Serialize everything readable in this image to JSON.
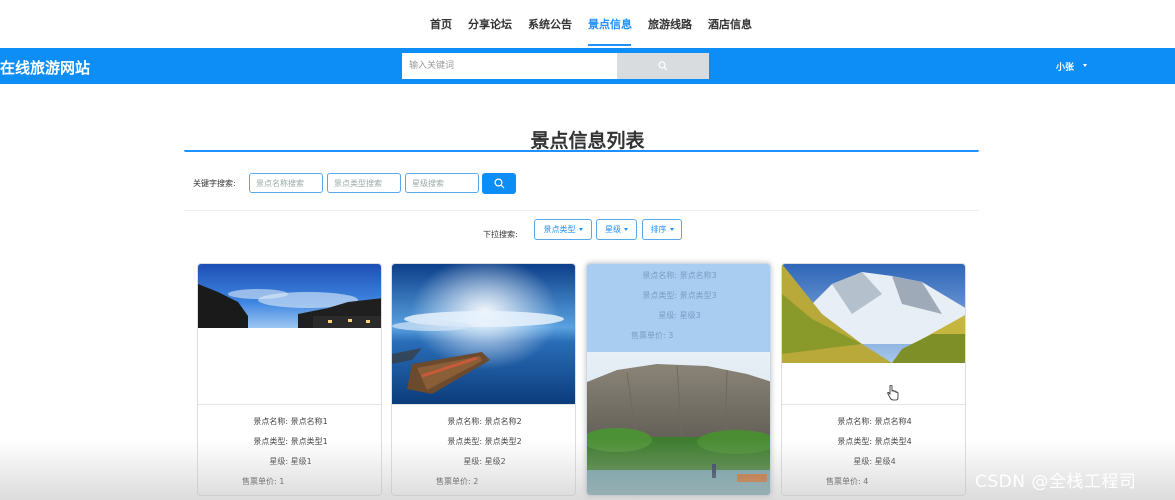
{
  "nav": {
    "items": [
      {
        "label": "首页"
      },
      {
        "label": "分享论坛"
      },
      {
        "label": "系统公告"
      },
      {
        "label": "景点信息"
      },
      {
        "label": "旅游线路"
      },
      {
        "label": "酒店信息"
      }
    ],
    "active": "景点信息"
  },
  "header": {
    "site_title": "在线旅游网站",
    "search_placeholder": "输入关键词",
    "user_name": "小张",
    "bar_color": "#0d8ef7"
  },
  "page": {
    "title": "景点信息列表",
    "keyword_label": "关键字搜索:",
    "name_placeholder": "景点名称搜索",
    "type_placeholder": "景点类型搜索",
    "level_placeholder": "星级搜索",
    "dropdown_label": "下拉搜索:",
    "dropdowns": [
      {
        "label": "景点类型"
      },
      {
        "label": "星级"
      },
      {
        "label": "排序"
      }
    ]
  },
  "cards": [
    {
      "name": "景点名称: 景点名称1",
      "type": "景点类型: 景点类型1",
      "level": "星级: 星级1",
      "price": "售票单价: 1"
    },
    {
      "name": "景点名称: 景点名称2",
      "type": "景点类型: 景点类型2",
      "level": "星级: 星级2",
      "price": "售票单价: 2"
    },
    {
      "name": "景点名称: 景点名称3",
      "type": "景点类型: 景点类型3",
      "level": "星级: 星级3",
      "price": "售票单价: 3"
    },
    {
      "name": "景点名称: 景点名称4",
      "type": "景点类型: 景点类型4",
      "level": "星级: 星级4",
      "price": "售票单价: 4"
    }
  ],
  "watermark": "CSDN @全栈工程司"
}
